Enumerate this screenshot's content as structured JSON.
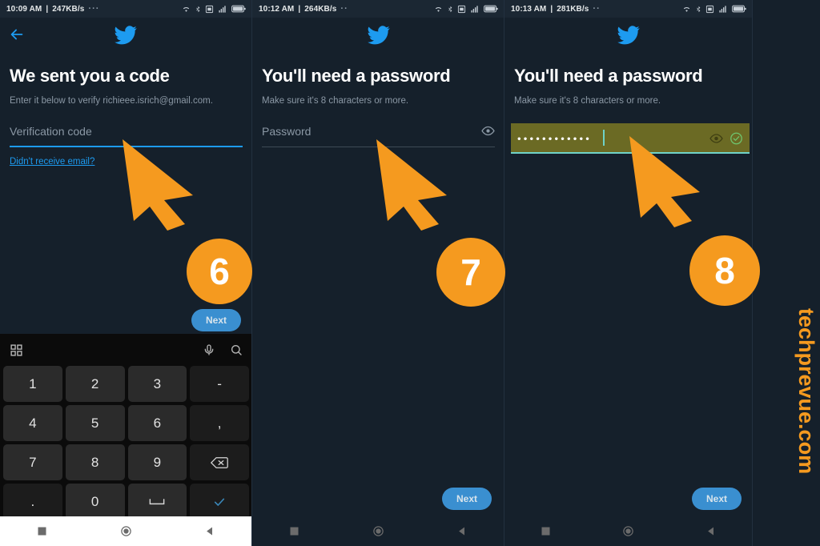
{
  "panels": [
    {
      "status": {
        "time": "10:09 AM",
        "speed": "247KB/s",
        "dots": "···"
      },
      "headline": "We sent you a code",
      "subtext": "Enter it below to verify richieee.isrich@gmail.com.",
      "field_placeholder": "Verification code",
      "helper_link": "Didn't receive email?",
      "next_label": "Next",
      "badge": "6"
    },
    {
      "status": {
        "time": "10:12 AM",
        "speed": "264KB/s",
        "dots": "··"
      },
      "headline": "You'll need a password",
      "subtext": "Make sure it's 8 characters or more.",
      "field_placeholder": "Password",
      "next_label": "Next",
      "badge": "7"
    },
    {
      "status": {
        "time": "10:13 AM",
        "speed": "281KB/s",
        "dots": "··"
      },
      "headline": "You'll need a password",
      "subtext": "Make sure it's 8 characters or more.",
      "field_value": "••••••••••••",
      "next_label": "Next",
      "badge": "8"
    }
  ],
  "keyboard": {
    "keys": [
      "1",
      "2",
      "3",
      "-",
      "4",
      "5",
      "6",
      ",",
      "7",
      "8",
      "9",
      "backspace-icon",
      ".",
      "0",
      "space-icon",
      "enter-check-icon"
    ]
  },
  "watermark": "techprevue.com",
  "colors": {
    "background": "#15202b",
    "accent_blue": "#1d9bf0",
    "badge_orange": "#f59a1f",
    "autofill_olive": "#6b6a24",
    "cursor_orange": "#f59a1f",
    "success_green": "#6ec46e"
  }
}
